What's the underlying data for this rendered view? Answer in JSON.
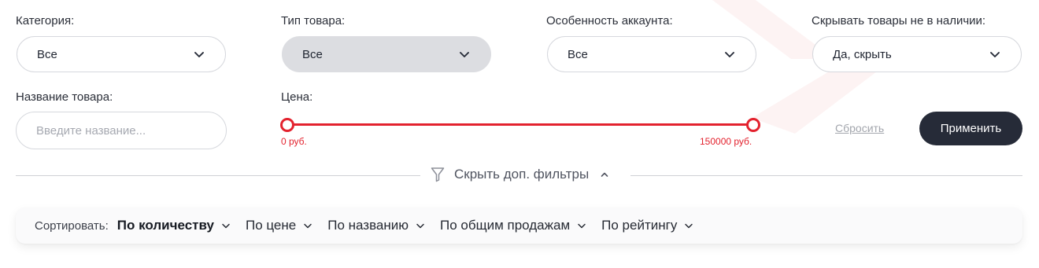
{
  "filters": {
    "category": {
      "label": "Категория:",
      "value": "Все"
    },
    "product_type": {
      "label": "Тип товара:",
      "value": "Все"
    },
    "account_feature": {
      "label": "Особенность аккаунта:",
      "value": "Все"
    },
    "hide_out_of_stock": {
      "label": "Скрывать товары не в наличии:",
      "value": "Да, скрыть"
    },
    "product_name": {
      "label": "Название товара:",
      "placeholder": "Введите название..."
    },
    "price": {
      "label": "Цена:",
      "min_label": "0 руб.",
      "max_label": "150000 руб.",
      "min_value": 0,
      "max_value": 150000,
      "accent_color": "#e3222e"
    },
    "reset_label": "Сбросить",
    "apply_label": "Применить",
    "toggle_label": "Скрыть доп. фильтры"
  },
  "sort": {
    "label": "Сортировать:",
    "items": [
      {
        "label": "По количеству",
        "active": true
      },
      {
        "label": "По цене",
        "active": false
      },
      {
        "label": "По названию",
        "active": false
      },
      {
        "label": "По общим продажам",
        "active": false
      },
      {
        "label": "По рейтингу",
        "active": false
      }
    ]
  },
  "icons": {
    "dropdown": "chevron-down-icon",
    "filter": "filter-icon",
    "collapse": "chevron-up-icon"
  },
  "colors": {
    "accent": "#e3222e",
    "apply_button": "#262b38",
    "selected_field": "#dcdde1"
  }
}
